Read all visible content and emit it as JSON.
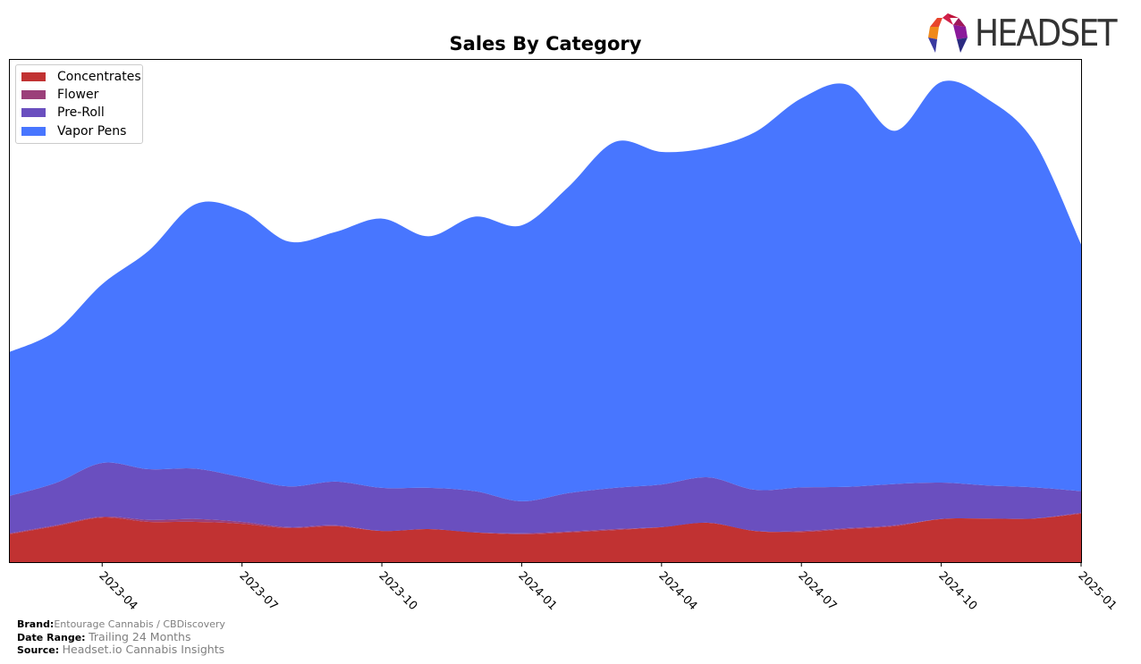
{
  "logo": {
    "text": "HEADSET"
  },
  "chart_data": {
    "type": "area",
    "stacked": true,
    "title": "Sales By Category",
    "xlabel": "",
    "ylabel": "",
    "x": [
      "2023-02",
      "2023-03",
      "2023-04",
      "2023-05",
      "2023-06",
      "2023-07",
      "2023-08",
      "2023-09",
      "2023-10",
      "2023-11",
      "2023-12",
      "2024-01",
      "2024-02",
      "2024-03",
      "2024-04",
      "2024-05",
      "2024-06",
      "2024-07",
      "2024-08",
      "2024-09",
      "2024-10",
      "2024-11",
      "2024-12",
      "2025-01"
    ],
    "xticks": [
      "2023-04",
      "2023-07",
      "2023-10",
      "2024-01",
      "2024-04",
      "2024-07",
      "2024-10",
      "2025-01"
    ],
    "y_units": "relative (no y-axis shown; max stacked total = 100)",
    "legend_position": "top-left",
    "grid": false,
    "series": [
      {
        "name": "Concentrates",
        "color": "#c13232",
        "values": [
          5.8,
          7.5,
          9.3,
          8.4,
          8.4,
          8.0,
          7.1,
          7.5,
          6.5,
          6.9,
          6.2,
          5.8,
          6.2,
          6.7,
          7.3,
          8.2,
          6.5,
          6.3,
          6.9,
          7.5,
          9.0,
          9.1,
          9.1,
          10.1
        ]
      },
      {
        "name": "Flower",
        "color": "#9b3f7a",
        "values": [
          0.2,
          0.2,
          0.2,
          0.4,
          0.6,
          0.4,
          0.2,
          0.2,
          0.0,
          0.0,
          0.0,
          0.2,
          0.2,
          0.2,
          0.0,
          0.0,
          0.0,
          0.2,
          0.2,
          0.2,
          0.0,
          0.0,
          0.0,
          0.2
        ]
      },
      {
        "name": "Pre-Roll",
        "color": "#6a4fbf",
        "values": [
          7.8,
          8.8,
          11.2,
          10.6,
          10.5,
          9.3,
          8.5,
          9.1,
          9.0,
          8.6,
          8.6,
          6.7,
          8.0,
          8.6,
          8.9,
          9.5,
          8.6,
          9.1,
          8.6,
          8.6,
          7.6,
          6.9,
          6.5,
          4.5
        ]
      },
      {
        "name": "Vapor Pens",
        "color": "#4876ff",
        "values": [
          30.0,
          31.7,
          37.3,
          45.6,
          55.2,
          55.6,
          51.1,
          52.1,
          56.2,
          52.5,
          57.3,
          57.6,
          63.9,
          72.2,
          69.4,
          68.8,
          74.6,
          81.2,
          83.9,
          73.7,
          83.6,
          80.6,
          72.0,
          51.5
        ]
      }
    ]
  },
  "footer": {
    "brand_label": "Brand:",
    "brand_value": "Entourage Cannabis / CBDiscovery",
    "date_label": "Date Range:",
    "date_value": "Trailing 24 Months",
    "source_label": "Source:",
    "source_value": "Headset.io Cannabis Insights"
  }
}
